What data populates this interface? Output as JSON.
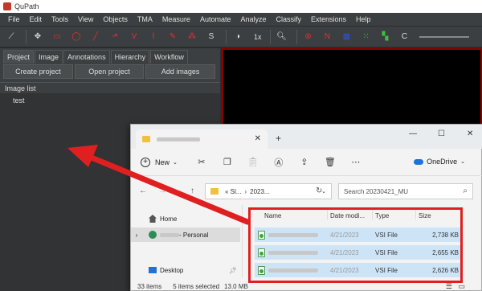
{
  "app": {
    "title": "QuPath"
  },
  "menubar": [
    "File",
    "Edit",
    "Tools",
    "View",
    "Objects",
    "TMA",
    "Measure",
    "Automate",
    "Analyze",
    "Classify",
    "Extensions",
    "Help"
  ],
  "toolbar": {
    "zoom_label": "1x",
    "s_label": "S",
    "n_label": "N",
    "c_label": "C"
  },
  "left_panel": {
    "tabs": [
      "Project",
      "Image",
      "Annotations",
      "Hierarchy",
      "Workflow"
    ],
    "buttons": [
      "Create project",
      "Open project",
      "Add images"
    ],
    "image_list_header": "Image list",
    "image_list_items": [
      "test"
    ]
  },
  "explorer": {
    "new_label": "New",
    "onedrive_label": "OneDrive",
    "path_prefix": "« Sl...",
    "path_mid": "2023...",
    "search_placeholder": "Search 20230421_MU",
    "nav": {
      "home": "Home",
      "personal": " - Personal",
      "desktop": "Desktop"
    },
    "columns": {
      "name": "Name",
      "date": "Date modi...",
      "type": "Type",
      "size": "Size"
    },
    "files": [
      {
        "date": "4/21/2023",
        "type": "VSI File",
        "size": "2,738 KB"
      },
      {
        "date": "4/21/2023",
        "type": "VSI File",
        "size": "2,655 KB"
      },
      {
        "date": "4/21/2023",
        "type": "VSI File",
        "size": "2,626 KB"
      }
    ],
    "status": {
      "items": "33 items",
      "selected": "5 items selected",
      "size": "13.0 MB"
    }
  },
  "colors": {
    "annotation_red": "#e02020",
    "selection_blue": "#cde4f7"
  }
}
